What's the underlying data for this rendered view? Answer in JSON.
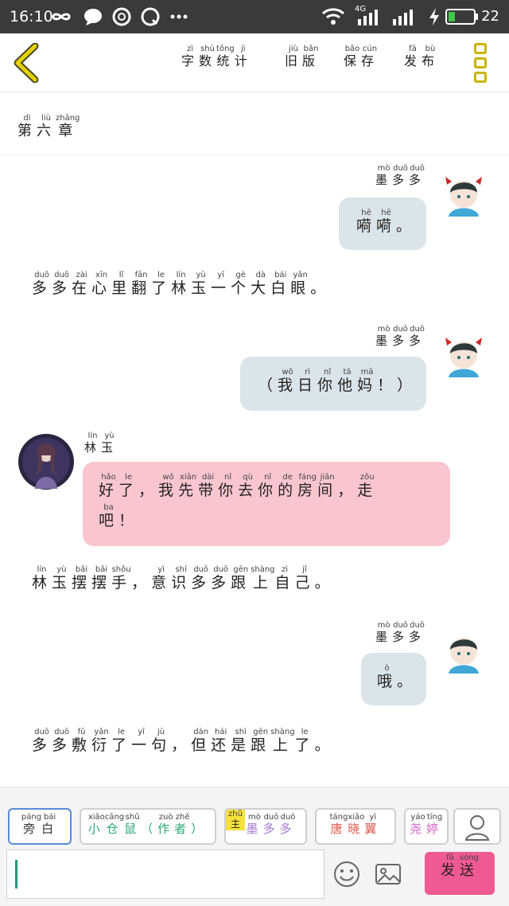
{
  "status": {
    "time": "16:10",
    "network": "4G",
    "battery": "22"
  },
  "header": {
    "actions": [
      {
        "label": [
          [
            "字",
            "zì"
          ],
          [
            "数",
            "shù"
          ],
          [
            "统",
            "tǒng"
          ],
          [
            "计",
            "jì"
          ]
        ]
      },
      {
        "label": [
          [
            "旧",
            "jiù"
          ],
          [
            "版",
            "bǎn"
          ]
        ]
      },
      {
        "label": [
          [
            "保",
            "bǎo"
          ],
          [
            "存",
            "cún"
          ]
        ]
      },
      {
        "label": [
          [
            "发",
            "fā"
          ],
          [
            "布",
            "bù"
          ]
        ]
      }
    ]
  },
  "chapter": {
    "title": [
      [
        "第",
        "dì"
      ],
      [
        "六",
        "liù"
      ],
      [
        "章",
        "zhāng"
      ]
    ]
  },
  "messages": {
    "m1_name": [
      [
        "墨",
        "mò"
      ],
      [
        "多",
        "duō"
      ],
      [
        "多",
        "duō"
      ]
    ],
    "m1_text": [
      [
        "嗬",
        "hē"
      ],
      [
        "嗬",
        "hē"
      ],
      [
        "。",
        ""
      ]
    ],
    "n1": [
      [
        "多",
        "duō"
      ],
      [
        "多",
        "duō"
      ],
      [
        "在",
        "zài"
      ],
      [
        "心",
        "xīn"
      ],
      [
        "里",
        "lǐ"
      ],
      [
        "翻",
        "fān"
      ],
      [
        "了",
        "le"
      ],
      [
        "林",
        "lín"
      ],
      [
        "玉",
        "yù"
      ],
      [
        "一",
        "yī"
      ],
      [
        "个",
        "gè"
      ],
      [
        "大",
        "dà"
      ],
      [
        "白",
        "bái"
      ],
      [
        "眼",
        "yǎn"
      ],
      [
        "。",
        ""
      ]
    ],
    "m2_name": [
      [
        "墨",
        "mò"
      ],
      [
        "多",
        "duō"
      ],
      [
        "多",
        "duō"
      ]
    ],
    "m2_text": [
      [
        "（",
        ""
      ],
      [
        "我",
        "wǒ"
      ],
      [
        "日",
        "rì"
      ],
      [
        "你",
        "nǐ"
      ],
      [
        "他",
        "tā"
      ],
      [
        "妈",
        "mā"
      ],
      [
        "！",
        ""
      ],
      [
        "）",
        ""
      ]
    ],
    "m3_name": [
      [
        "林",
        "lín"
      ],
      [
        "玉",
        "yù"
      ]
    ],
    "m3_line1": [
      [
        "好",
        "hǎo"
      ],
      [
        "了",
        "le"
      ],
      [
        "，",
        ""
      ],
      [
        "我",
        "wǒ"
      ],
      [
        "先",
        "xiān"
      ],
      [
        "带",
        "dài"
      ],
      [
        "你",
        "nǐ"
      ],
      [
        "去",
        "qù"
      ],
      [
        "你",
        "nǐ"
      ],
      [
        "的",
        "de"
      ],
      [
        "房",
        "fáng"
      ],
      [
        "间",
        "jiān"
      ],
      [
        "，",
        ""
      ],
      [
        "走",
        "zǒu"
      ]
    ],
    "m3_line2": [
      [
        "吧",
        "ba"
      ],
      [
        "！",
        ""
      ]
    ],
    "n2": [
      [
        "林",
        "lín"
      ],
      [
        "玉",
        "yù"
      ],
      [
        "摆",
        "bǎi"
      ],
      [
        "摆",
        "bǎi"
      ],
      [
        "手",
        "shǒu"
      ],
      [
        "，",
        ""
      ],
      [
        "意",
        "yì"
      ],
      [
        "识",
        "shí"
      ],
      [
        "多",
        "duō"
      ],
      [
        "多",
        "duō"
      ],
      [
        "跟",
        "gēn"
      ],
      [
        "上",
        "shàng"
      ],
      [
        "自",
        "zì"
      ],
      [
        "己",
        "jǐ"
      ],
      [
        "。",
        ""
      ]
    ],
    "m4_name": [
      [
        "墨",
        "mò"
      ],
      [
        "多",
        "duō"
      ],
      [
        "多",
        "duō"
      ]
    ],
    "m4_text": [
      [
        "哦",
        "ò"
      ],
      [
        "。",
        ""
      ]
    ],
    "n3": [
      [
        "多",
        "duō"
      ],
      [
        "多",
        "duō"
      ],
      [
        "敷",
        "fū"
      ],
      [
        "衍",
        "yǎn"
      ],
      [
        "了",
        "le"
      ],
      [
        "一",
        "yī"
      ],
      [
        "句",
        "jù"
      ],
      [
        "，",
        ""
      ],
      [
        "但",
        "dàn"
      ],
      [
        "还",
        "hái"
      ],
      [
        "是",
        "shì"
      ],
      [
        "跟",
        "gēn"
      ],
      [
        "上",
        "shàng"
      ],
      [
        "了",
        "le"
      ],
      [
        "。",
        ""
      ]
    ]
  },
  "characters": [
    {
      "label": [
        [
          "旁",
          "páng"
        ],
        [
          "白",
          "bái"
        ]
      ],
      "color": "#333333"
    },
    {
      "label": [
        [
          "小",
          "xiǎo"
        ],
        [
          "仓",
          "cāng"
        ],
        [
          "鼠",
          "shǔ"
        ],
        [
          "（",
          ""
        ],
        [
          "作",
          "zuò"
        ],
        [
          "者",
          "zhě"
        ],
        [
          "）",
          ""
        ]
      ],
      "color": "#2aa876"
    },
    {
      "tag": "主",
      "tag_pinyin": "zhǔ",
      "label": [
        [
          "墨",
          "mò"
        ],
        [
          "多",
          "duō"
        ],
        [
          "多",
          "duō"
        ]
      ],
      "color": "#a57bd6"
    },
    {
      "label": [
        [
          "唐",
          "táng"
        ],
        [
          "晓",
          "xiǎo"
        ],
        [
          "翼",
          "yì"
        ]
      ],
      "color": "#e0574a"
    },
    {
      "label": [
        [
          "尧",
          "yáo"
        ],
        [
          "婷",
          "tíng"
        ]
      ],
      "color": "#d466c8"
    }
  ],
  "input": {
    "value": ""
  },
  "send": {
    "label": [
      [
        "发",
        "fā"
      ],
      [
        "送",
        "sòng"
      ]
    ]
  },
  "colors": {
    "bubble_me": "#dbe4e9",
    "bubble_other": "#f9c6d0",
    "send": "#f05a92",
    "accent": "#c8b400"
  },
  "icons": [
    "back-arrow-icon",
    "menu-icon",
    "user-icon",
    "emoji-icon",
    "image-icon"
  ]
}
